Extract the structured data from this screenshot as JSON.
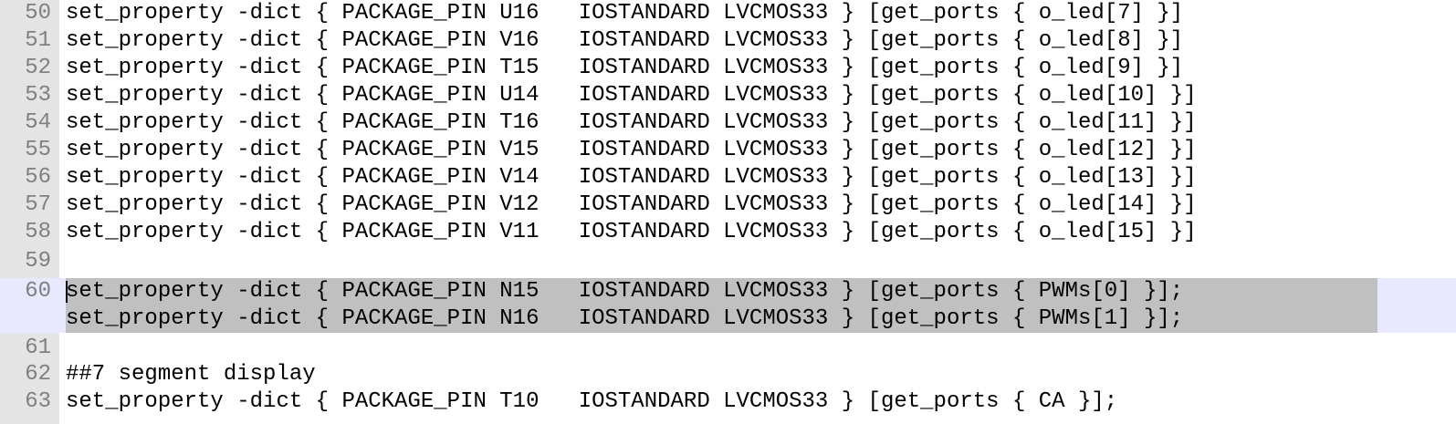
{
  "editor": {
    "lines": [
      {
        "num": "50",
        "text": "set_property -dict { PACKAGE_PIN U16   IOSTANDARD LVCMOS33 } [get_ports { o_led[7] }]"
      },
      {
        "num": "51",
        "text": "set_property -dict { PACKAGE_PIN V16   IOSTANDARD LVCMOS33 } [get_ports { o_led[8] }]"
      },
      {
        "num": "52",
        "text": "set_property -dict { PACKAGE_PIN T15   IOSTANDARD LVCMOS33 } [get_ports { o_led[9] }]"
      },
      {
        "num": "53",
        "text": "set_property -dict { PACKAGE_PIN U14   IOSTANDARD LVCMOS33 } [get_ports { o_led[10] }]"
      },
      {
        "num": "54",
        "text": "set_property -dict { PACKAGE_PIN T16   IOSTANDARD LVCMOS33 } [get_ports { o_led[11] }]"
      },
      {
        "num": "55",
        "text": "set_property -dict { PACKAGE_PIN V15   IOSTANDARD LVCMOS33 } [get_ports { o_led[12] }]"
      },
      {
        "num": "56",
        "text": "set_property -dict { PACKAGE_PIN V14   IOSTANDARD LVCMOS33 } [get_ports { o_led[13] }]"
      },
      {
        "num": "57",
        "text": "set_property -dict { PACKAGE_PIN V12   IOSTANDARD LVCMOS33 } [get_ports { o_led[14] }]"
      },
      {
        "num": "58",
        "text": "set_property -dict { PACKAGE_PIN V11   IOSTANDARD LVCMOS33 } [get_ports { o_led[15] }]"
      },
      {
        "num": "59",
        "text": ""
      },
      {
        "num": "60",
        "text": "set_property -dict { PACKAGE_PIN N15   IOSTANDARD LVCMOS33 } [get_ports { PWMs[0] }];"
      },
      {
        "num": "",
        "text": "set_property -dict { PACKAGE_PIN N16   IOSTANDARD LVCMOS33 } [get_ports { PWMs[1] }];"
      },
      {
        "num": "61",
        "text": ""
      },
      {
        "num": "62",
        "text": "##7 segment display"
      },
      {
        "num": "63",
        "text": "set_property -dict { PACKAGE_PIN T10   IOSTANDARD LVCMOS33 } [get_ports { CA }];"
      }
    ]
  },
  "colors": {
    "gutter_bg": "#e4e4e4",
    "line_number": "#808080",
    "selection": "#c0c0c0",
    "current_line": "#e8e8ff",
    "text": "#000000"
  }
}
